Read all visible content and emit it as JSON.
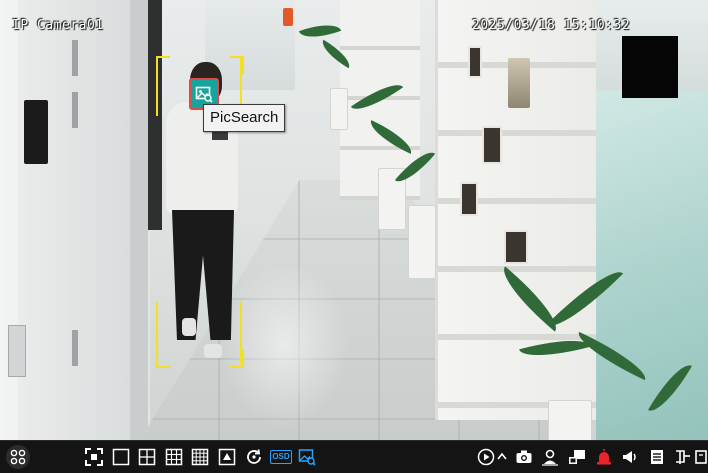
{
  "osd": {
    "camera_name": "IP Camera01",
    "timestamp": "2025/03/18 15:10:32"
  },
  "detection": {
    "tooltip": "PicSearch",
    "box_color": "#f4e021",
    "icon": "image-search-icon"
  },
  "toolbar": {
    "menu_icon": "grid-menu-icon",
    "layout_buttons": [
      "fullscreen-icon",
      "layout-1-icon",
      "layout-4-icon",
      "layout-9-icon",
      "layout-16-icon",
      "sequence-icon",
      "refresh-icon"
    ],
    "osd_label": "OSD",
    "active_color": "#2aa3ff",
    "right_buttons": [
      "playback-icon",
      "expand-up-icon",
      "snapshot-icon",
      "face-icon",
      "audio-icon",
      "alarm-icon",
      "speaker-icon",
      "list-icon",
      "tag-icon",
      "more-icon"
    ]
  }
}
